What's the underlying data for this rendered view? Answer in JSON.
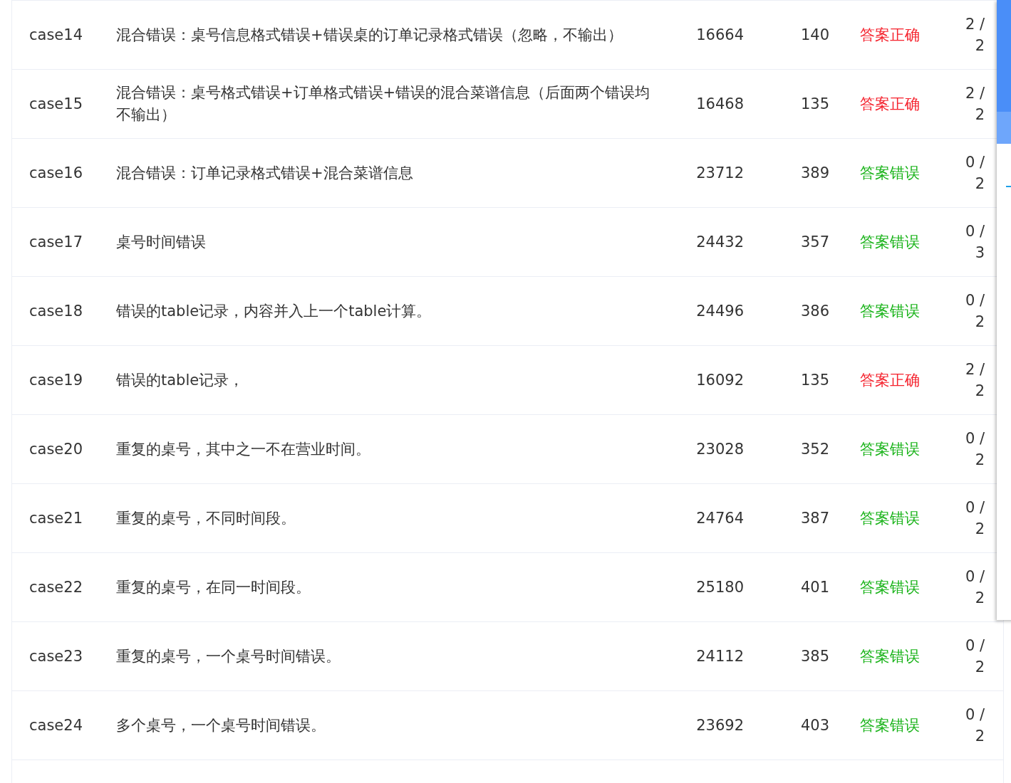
{
  "rows": [
    {
      "case": "case14",
      "description": "混合错误：桌号信息格式错误+错误桌的订单记录格式错误（忽略，不输出）",
      "time": "16664",
      "memory": "140",
      "result": "答案正确",
      "kind": "correct",
      "score": "2 / 2"
    },
    {
      "case": "case15",
      "description": "混合错误：桌号格式错误+订单格式错误+错误的混合菜谱信息（后面两个错误均不输出）",
      "time": "16468",
      "memory": "135",
      "result": "答案正确",
      "kind": "correct",
      "score": "2 / 2"
    },
    {
      "case": "case16",
      "description": "混合错误：订单记录格式错误+混合菜谱信息",
      "time": "23712",
      "memory": "389",
      "result": "答案错误",
      "kind": "wrong",
      "score": "0 / 2"
    },
    {
      "case": "case17",
      "description": "桌号时间错误",
      "time": "24432",
      "memory": "357",
      "result": "答案错误",
      "kind": "wrong",
      "score": "0 / 3"
    },
    {
      "case": "case18",
      "description": "错误的table记录，内容并入上一个table计算。",
      "time": "24496",
      "memory": "386",
      "result": "答案错误",
      "kind": "wrong",
      "score": "0 / 2"
    },
    {
      "case": "case19",
      "description": "错误的table记录，",
      "time": "16092",
      "memory": "135",
      "result": "答案正确",
      "kind": "correct",
      "score": "2 / 2"
    },
    {
      "case": "case20",
      "description": "重复的桌号，其中之一不在营业时间。",
      "time": "23028",
      "memory": "352",
      "result": "答案错误",
      "kind": "wrong",
      "score": "0 / 2"
    },
    {
      "case": "case21",
      "description": "重复的桌号，不同时间段。",
      "time": "24764",
      "memory": "387",
      "result": "答案错误",
      "kind": "wrong",
      "score": "0 / 2"
    },
    {
      "case": "case22",
      "description": "重复的桌号，在同一时间段。",
      "time": "25180",
      "memory": "401",
      "result": "答案错误",
      "kind": "wrong",
      "score": "0 / 2"
    },
    {
      "case": "case23",
      "description": "重复的桌号，一个桌号时间错误。",
      "time": "24112",
      "memory": "385",
      "result": "答案错误",
      "kind": "wrong",
      "score": "0 / 2"
    },
    {
      "case": "case24",
      "description": "多个桌号，一个桌号时间错误。",
      "time": "23692",
      "memory": "403",
      "result": "答案错误",
      "kind": "wrong",
      "score": "0 / 2"
    }
  ]
}
